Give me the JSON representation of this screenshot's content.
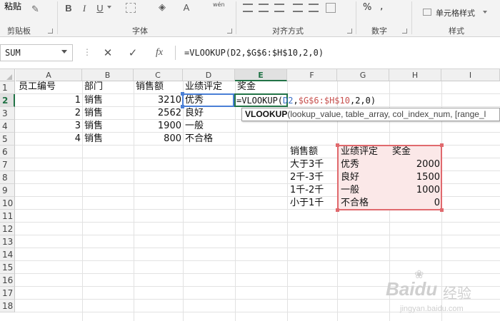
{
  "ribbon": {
    "paste_label": "粘贴",
    "groups": {
      "clipboard": "剪贴板",
      "font": "字体",
      "alignment": "对齐方式",
      "number": "数字",
      "styles": "样式"
    },
    "font_buttons": [
      "B",
      "I",
      "U"
    ],
    "wen_label": "wén",
    "cell_styles_label": "单元格样式",
    "percent_label": "%",
    "comma_label": ","
  },
  "formula_bar": {
    "name_box": "SUM",
    "cancel_icon": "✕",
    "enter_icon": "✓",
    "fx_icon": "fx",
    "formula": "=VLOOKUP(D2,$G$6:$H$10,2,0)"
  },
  "columns": [
    "A",
    "B",
    "C",
    "D",
    "E",
    "F",
    "G",
    "H",
    "I"
  ],
  "active_column": "E",
  "rows": [
    "1",
    "2",
    "3",
    "4",
    "5",
    "6",
    "7",
    "8",
    "9",
    "10",
    "11",
    "12",
    "13",
    "14",
    "15",
    "16",
    "17",
    "18"
  ],
  "active_row": "2",
  "main_table": {
    "headers": [
      "员工编号",
      "部门",
      "销售额",
      "业绩评定",
      "奖金"
    ],
    "rows": [
      [
        "1",
        "销售",
        "3210",
        "优秀"
      ],
      [
        "2",
        "销售",
        "2562",
        "良好"
      ],
      [
        "3",
        "销售",
        "1900",
        "一般"
      ],
      [
        "4",
        "销售",
        "800",
        "不合格"
      ]
    ]
  },
  "edit_cell": {
    "prefix": "=VLOOKUP(",
    "arg1": "D2",
    "comma1": ",",
    "arg2": "$G$6:$H$10",
    "rest": ",2,0)"
  },
  "tooltip": {
    "func": "VLOOKUP",
    "args": "(lookup_value, table_array, col_index_num, [range_l"
  },
  "lookup_table": {
    "f_header": "销售额",
    "f_values": [
      "大于3千",
      "2千-3千",
      "1千-2千",
      "小于1千"
    ],
    "g_header": "业绩评定",
    "h_header": "奖金",
    "rows": [
      [
        "优秀",
        "2000"
      ],
      [
        "良好",
        "1500"
      ],
      [
        "一般",
        "1000"
      ],
      [
        "不合格",
        "0"
      ]
    ]
  },
  "watermark": {
    "brand": "Baidu",
    "suffix": "经验",
    "url": "jingyan.baidu.com"
  },
  "colors": {
    "accent_green": "#217346",
    "arg_blue": "#3b6fc8",
    "arg_red": "#c8524f",
    "range_border": "#e0696d",
    "range_fill": "#fbe8e8"
  }
}
